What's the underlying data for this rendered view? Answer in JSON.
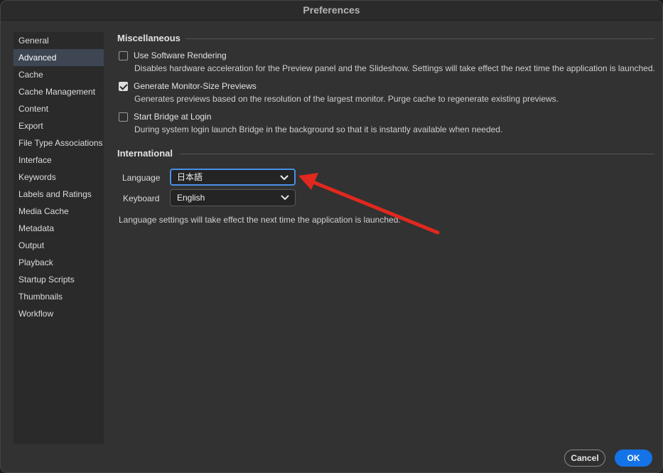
{
  "window": {
    "title": "Preferences"
  },
  "sidebar": {
    "items": [
      {
        "label": "General"
      },
      {
        "label": "Advanced",
        "active": true
      },
      {
        "label": "Cache"
      },
      {
        "label": "Cache Management"
      },
      {
        "label": "Content"
      },
      {
        "label": "Export"
      },
      {
        "label": "File Type Associations"
      },
      {
        "label": "Interface"
      },
      {
        "label": "Keywords"
      },
      {
        "label": "Labels and Ratings"
      },
      {
        "label": "Media Cache"
      },
      {
        "label": "Metadata"
      },
      {
        "label": "Output"
      },
      {
        "label": "Playback"
      },
      {
        "label": "Startup Scripts"
      },
      {
        "label": "Thumbnails"
      },
      {
        "label": "Workflow"
      }
    ]
  },
  "misc": {
    "header": "Miscellaneous",
    "options": [
      {
        "label": "Use Software Rendering",
        "checked": false,
        "description": "Disables hardware acceleration for the Preview panel and the Slideshow. Settings will take effect the next time the application is launched."
      },
      {
        "label": "Generate Monitor-Size Previews",
        "checked": true,
        "description": "Generates previews based on the resolution of the largest monitor.  Purge cache to regenerate existing previews."
      },
      {
        "label": "Start Bridge at Login",
        "checked": false,
        "description": "During system login launch Bridge in the background so that it is instantly available when needed."
      }
    ]
  },
  "international": {
    "header": "International",
    "language_label": "Language",
    "language_value": "日本語",
    "keyboard_label": "Keyboard",
    "keyboard_value": "English",
    "note": "Language settings will take effect the next time the application is launched."
  },
  "footer": {
    "cancel_label": "Cancel",
    "ok_label": "OK"
  },
  "colors": {
    "accent": "#1473e6",
    "focus_ring": "#4a8fe7",
    "annotation_arrow": "#e0281e"
  }
}
